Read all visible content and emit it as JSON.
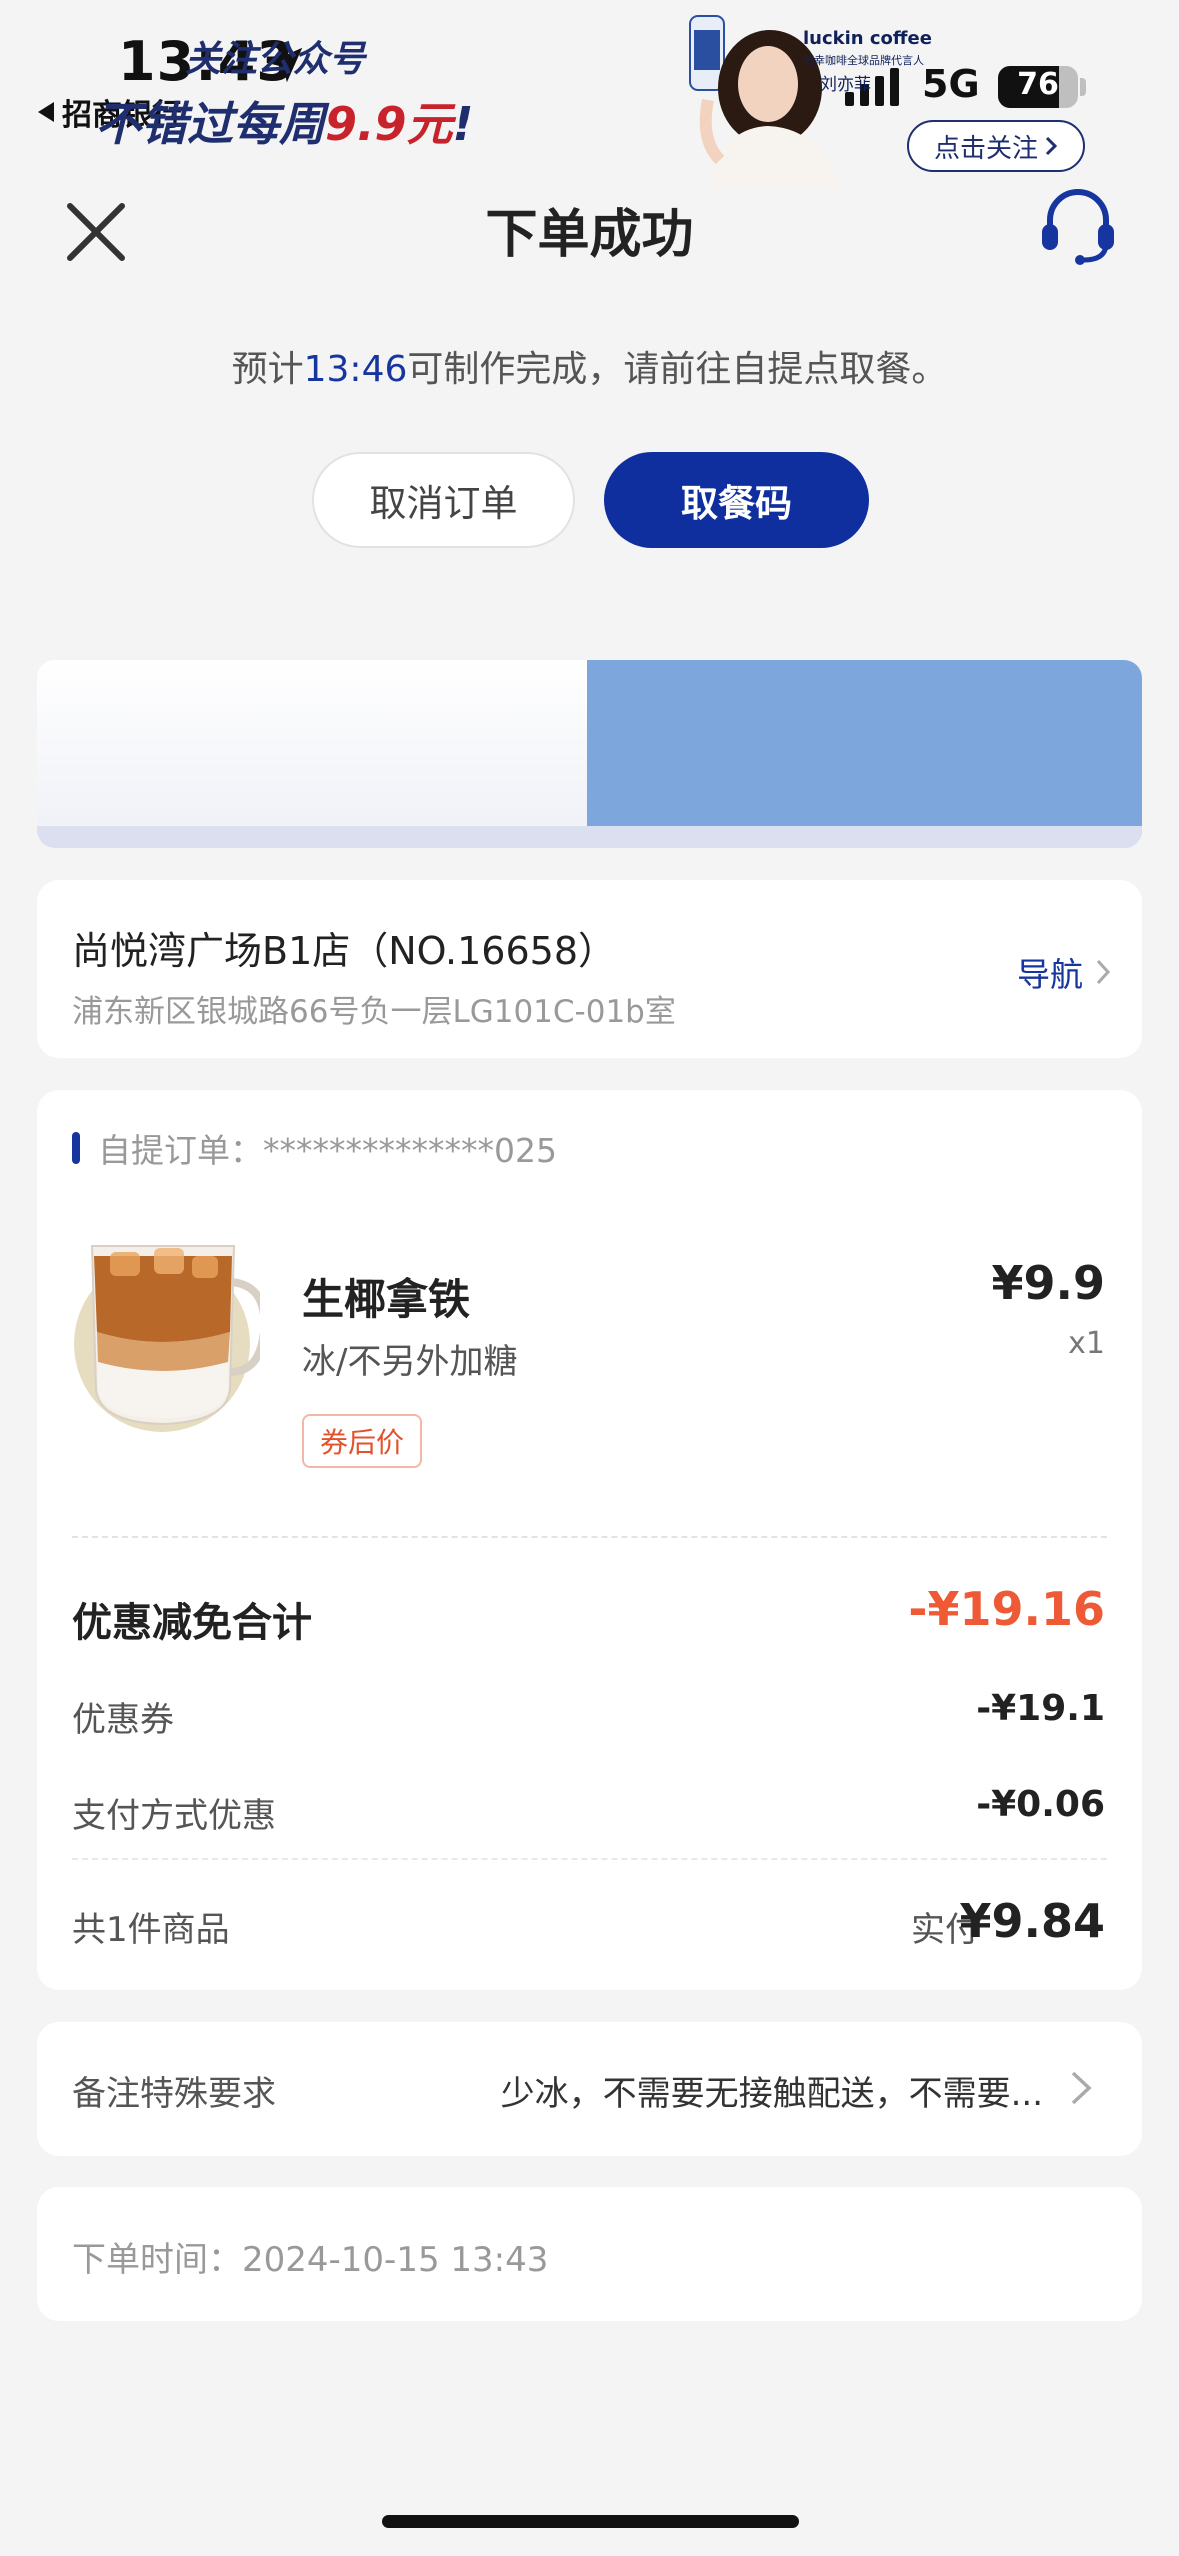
{
  "status_bar": {
    "time": "13:43",
    "back_app": "招商银行",
    "network": "5G",
    "battery": "76",
    "battery_level": 0.76
  },
  "header": {
    "title": "下单成功",
    "close_icon": "close-icon",
    "service_icon": "headset-icon"
  },
  "eta": {
    "prefix": "预计",
    "time": "13:46",
    "suffix": "可制作完成，请前往自提点取餐。"
  },
  "actions": {
    "cancel_label": "取消订单",
    "pickup_code_label": "取餐码"
  },
  "banner": {
    "line1": "关注公众号",
    "line2_prefix": "不错过每周",
    "line2_price": "9.9元",
    "line2_suffix": "!",
    "brand": "luckin coffee",
    "subtitle": "瑞幸咖啡全球品牌代言人",
    "person": "刘亦菲",
    "follow_label": "点击关注"
  },
  "store": {
    "name": "尚悦湾广场B1店（NO.16658）",
    "address": "浦东新区银城路66号负一层LG101C-01b室",
    "nav_label": "导航"
  },
  "order": {
    "label": "自提订单：",
    "number": "**************025",
    "product": {
      "name": "生椰拿铁",
      "spec": "冰/不另外加糖",
      "tag": "券后价",
      "price": "¥9.9",
      "qty": "x1"
    },
    "discount_title": "优惠减免合计",
    "discount_total": "-¥19.16",
    "coupon_label": "优惠券",
    "coupon_value": "-¥19.1",
    "payment_label": "支付方式优惠",
    "payment_value": "-¥0.06",
    "count_label": "共1件商品",
    "paid_label": "实付",
    "paid_value": "¥9.84"
  },
  "remark": {
    "label": "备注特殊要求",
    "value": "少冰，不需要无接触配送，不需要..."
  },
  "order_time": {
    "label": "下单时间：",
    "value": "2024-10-15 13:43"
  },
  "colors": {
    "brand_blue": "#0f2f9e",
    "discount_red": "#ee5a36",
    "background": "#f4f4f4"
  }
}
